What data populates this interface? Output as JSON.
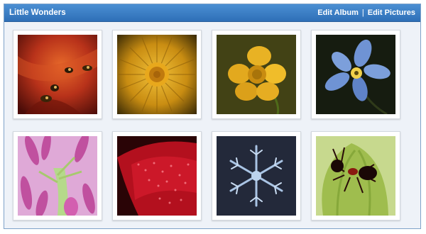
{
  "header": {
    "title": "Little Wonders",
    "edit_album": "Edit Album",
    "separator": "|",
    "edit_pictures": "Edit Pictures"
  },
  "colors": {
    "header_blue": "#2e6fb7",
    "panel_background": "#eef2f8"
  },
  "gallery": {
    "photos": [
      {
        "subject": "insect-on-red-petals-photo"
      },
      {
        "subject": "yellow-dandelion-photo"
      },
      {
        "subject": "yellow-buttercup-photo"
      },
      {
        "subject": "blue-star-flower-photo"
      },
      {
        "subject": "pink-clover-photo"
      },
      {
        "subject": "red-petal-droplets-photo"
      },
      {
        "subject": "snowflake-photo"
      },
      {
        "subject": "ant-on-bud-photo"
      }
    ]
  }
}
